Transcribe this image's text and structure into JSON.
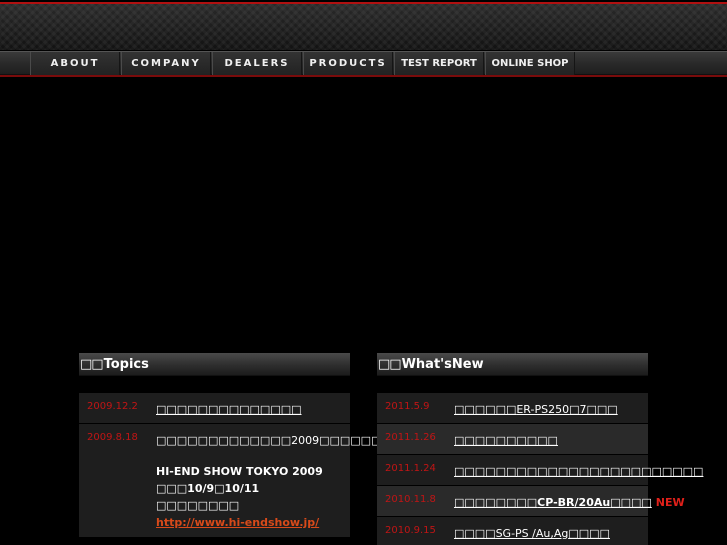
{
  "nav": {
    "items": [
      {
        "label": "ABOUT"
      },
      {
        "label": "COMPANY"
      },
      {
        "label": "DEALERS"
      },
      {
        "label": "PRODUCTS"
      },
      {
        "label": "TEST REPORT"
      },
      {
        "label": "ONLINE SHOP"
      }
    ]
  },
  "topics": {
    "mark": "□□",
    "heading": "Topics",
    "items": [
      {
        "date": "2009.12.2",
        "title": "□□□□□□□□□□□□□□"
      },
      {
        "date": "2009.8.18",
        "title": "□□□□□□□□□□□□□2009□□□□□□",
        "lines": [
          "HI-END SHOW TOKYO 2009",
          "□□□10/9□10/11",
          "□□□□□□□□"
        ],
        "link": "http://www.hi-endshow.jp/"
      }
    ]
  },
  "whatsnew": {
    "mark": "□□",
    "heading": "What'sNew",
    "items": [
      {
        "date": "2011.5.9",
        "title_prefix": "□□□□□□",
        "title_code": "ER-PS250",
        "title_suffix": "□7□□□"
      },
      {
        "date": "2011.1.26",
        "title": "□□□□□□□□□□"
      },
      {
        "date": "2011.1.24",
        "title": "□□□□□□□□□□□□□□□□□□□□□□□□"
      },
      {
        "date": "2010.11.8",
        "title_prefix": "□□□□□□□□",
        "title_code": "CP-BR/20Au",
        "title_suffix": "□□□□",
        "badge": "NEW"
      },
      {
        "date": "2010.9.15",
        "title_prefix": "□□□□",
        "title_code": "SG-PS /Au,Ag",
        "title_suffix": "□□□□"
      }
    ]
  }
}
